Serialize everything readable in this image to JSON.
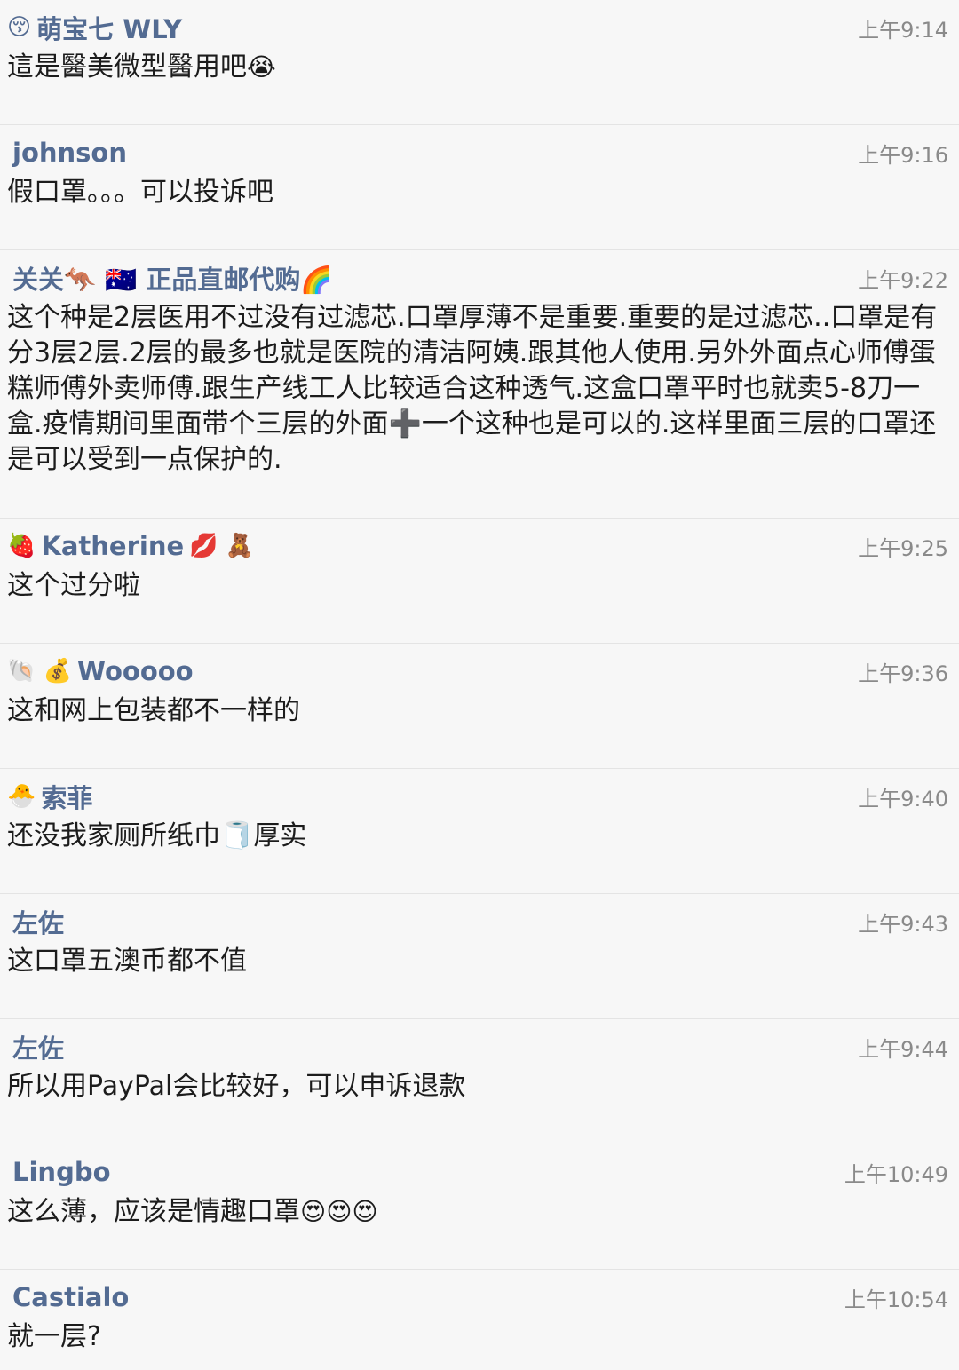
{
  "comments": [
    {
      "author_prefix": "😚",
      "author": "萌宝七 WLY",
      "author_suffix": "",
      "time": "上午9:14",
      "text": "這是醫美微型醫用吧",
      "text_suffix": "😭"
    },
    {
      "author_prefix": "",
      "author": "johnson",
      "author_suffix": "",
      "time": "上午9:16",
      "text": "假口罩。。。可以投诉吧",
      "text_suffix": ""
    },
    {
      "author_prefix": "",
      "author": "关关🦘 🇦🇺 正品直邮代购🌈",
      "author_suffix": "",
      "time": "上午9:22",
      "text": "这个种是2层医用不过没有过滤芯.口罩厚薄不是重要.重要的是过滤芯..口罩是有分3层2层.2层的最多也就是医院的清洁阿姨.跟其他人使用.另外外面点心师傅蛋糕师傅外卖师傅.跟生产线工人比较适合这种透气.这盒口罩平时也就卖5-8刀一盒.疫情期间里面带个三层的外面➕一个这种也是可以的.这样里面三层的口罩还是可以受到一点保护的.",
      "text_suffix": ""
    },
    {
      "author_prefix": "🍓",
      "author": "Katherine",
      "author_suffix": "💋 🧸",
      "time": "上午9:25",
      "text": "这个过分啦",
      "text_suffix": ""
    },
    {
      "author_prefix": "🐚 💰",
      "author": "Wooooo",
      "author_suffix": "",
      "time": "上午9:36",
      "text": "这和网上包装都不一样的",
      "text_suffix": ""
    },
    {
      "author_prefix": "🐣",
      "author": "索菲",
      "author_suffix": "",
      "time": "上午9:40",
      "text": "还没我家厕所纸巾🧻厚实",
      "text_suffix": ""
    },
    {
      "author_prefix": "",
      "author": "左佐",
      "author_suffix": "",
      "time": "上午9:43",
      "text": "这口罩五澳币都不值",
      "text_suffix": ""
    },
    {
      "author_prefix": "",
      "author": "左佐",
      "author_suffix": "",
      "time": "上午9:44",
      "text": "所以用PayPal会比较好，可以申诉退款",
      "text_suffix": ""
    },
    {
      "author_prefix": "",
      "author": "Lingbo",
      "author_suffix": "",
      "time": "上午10:49",
      "text": "这么薄，应该是情趣口罩",
      "text_suffix": "😍😍😍"
    },
    {
      "author_prefix": "",
      "author": "Castialo",
      "author_suffix": "",
      "time": "上午10:54",
      "text": "就一层?",
      "text_suffix": ""
    }
  ]
}
